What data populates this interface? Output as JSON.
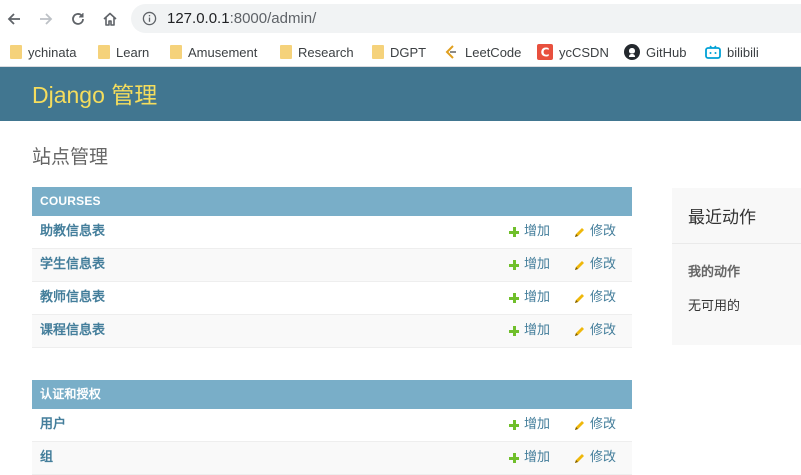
{
  "browser": {
    "url_host": "127.0.0.1",
    "url_path": ":8000/admin/",
    "bookmarks": [
      {
        "label": "ychinata",
        "icon": "folder-icon"
      },
      {
        "label": "Learn",
        "icon": "folder-icon"
      },
      {
        "label": "Amusement",
        "icon": "folder-icon"
      },
      {
        "label": "Research",
        "icon": "folder-icon"
      },
      {
        "label": "DGPT",
        "icon": "folder-icon"
      },
      {
        "label": "LeetCode",
        "icon": "leetcode-icon"
      },
      {
        "label": "ycCSDN",
        "icon": "csdn-icon"
      },
      {
        "label": "GitHub",
        "icon": "github-icon"
      },
      {
        "label": "bilibili",
        "icon": "bilibili-icon"
      }
    ]
  },
  "header": {
    "brand": "Django 管理",
    "brand_color": "#f5dd5d",
    "bg_color": "#417690"
  },
  "page_title": "站点管理",
  "modules": [
    {
      "caption": "COURSES",
      "rows": [
        {
          "name": "助教信息表",
          "add": "增加",
          "change": "修改"
        },
        {
          "name": "学生信息表",
          "add": "增加",
          "change": "修改"
        },
        {
          "name": "教师信息表",
          "add": "增加",
          "change": "修改"
        },
        {
          "name": "课程信息表",
          "add": "增加",
          "change": "修改"
        }
      ]
    },
    {
      "caption": "认证和授权",
      "rows": [
        {
          "name": "用户",
          "add": "增加",
          "change": "修改"
        },
        {
          "name": "组",
          "add": "增加",
          "change": "修改"
        }
      ]
    }
  ],
  "recent_actions": {
    "title": "最近动作",
    "subtitle": "我的动作",
    "empty": "无可用的"
  }
}
